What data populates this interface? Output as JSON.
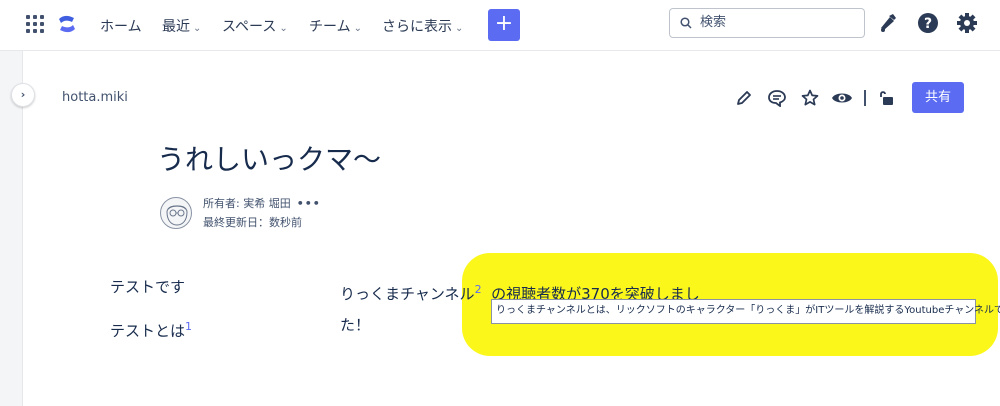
{
  "nav": {
    "home": "ホーム",
    "recent": "最近",
    "spaces": "スペース",
    "teams": "チーム",
    "more": "さらに表示",
    "create": "+"
  },
  "search": {
    "placeholder": "検索"
  },
  "breadcrumb": "hotta.miki",
  "toolbar": {
    "share_label": "共有"
  },
  "page": {
    "title": "うれしいっクマ～",
    "owner": "所有者: 実希 堀田",
    "more": "•••",
    "updated": "最終更新日：数秒前"
  },
  "content": {
    "line1": "テストです",
    "line2": "テストとは",
    "footnote1": "1",
    "para_part1": "りっくまチャンネル",
    "footnote2": "2",
    "para_part2": "の視聴者数が370を突破しまし",
    "para_part3": "た！",
    "tooltip": "りっくまチャンネルとは、リックソフトのキャラクター「りっくま」がITツールを解説するYoutubeチャンネルです。"
  },
  "colors": {
    "accent": "#5b6cf2",
    "highlight": "#fbf71b",
    "text": "#172b4d"
  },
  "icons": [
    "apps-grid-icon",
    "confluence-logo-icon",
    "search-icon",
    "notification-icon",
    "help-icon",
    "settings-icon",
    "edit-icon",
    "comment-icon",
    "star-icon",
    "watch-icon",
    "unlock-icon",
    "expand-sidebar-icon"
  ]
}
